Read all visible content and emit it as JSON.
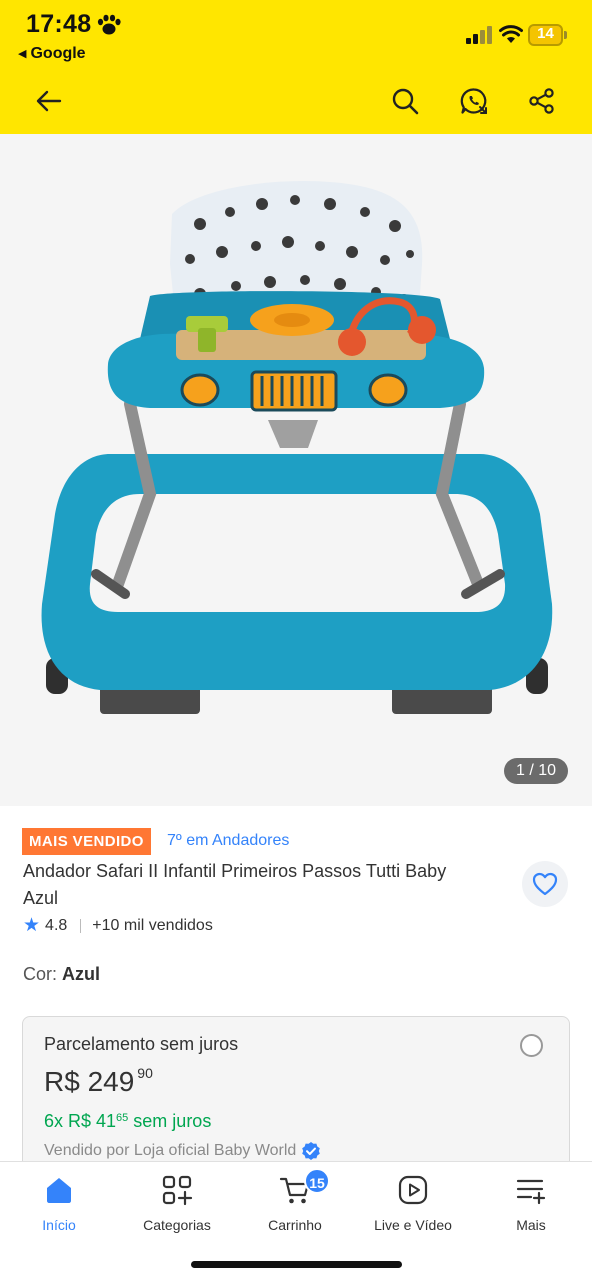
{
  "status_bar": {
    "time": "17:48",
    "back_app": "Google",
    "battery": "14"
  },
  "toolbar": {
    "icons": [
      "back-arrow-icon",
      "search-icon",
      "whatsapp-icon",
      "share-icon"
    ]
  },
  "gallery": {
    "counter": "1 / 10"
  },
  "product": {
    "badge": "MAIS VENDIDO",
    "rank": "7º em Andadores",
    "title": "Andador Safari II Infantil Primeiros Passos Tutti Baby Azul",
    "rating": "4.8",
    "sold": "+10 mil vendidos",
    "color_label": "Cor:",
    "color_value": "Azul"
  },
  "installment": {
    "title": "Parcelamento sem juros",
    "price_main": "R$ 249",
    "price_cents": "90",
    "install_text": "6x R$ 41",
    "install_cents": "65",
    "install_suffix": " sem juros",
    "seller": "Vendido por Loja oficial Baby World"
  },
  "bottom_nav": {
    "items": [
      {
        "label": "Início",
        "icon": "home-icon",
        "active": true
      },
      {
        "label": "Categorias",
        "icon": "categories-icon"
      },
      {
        "label": "Carrinho",
        "icon": "cart-icon",
        "badge": "15"
      },
      {
        "label": "Live e Vídeo",
        "icon": "play-icon"
      },
      {
        "label": "Mais",
        "icon": "menu-plus-icon"
      }
    ]
  },
  "colors": {
    "header_yellow": "#ffe600",
    "accent_blue": "#3483fa",
    "badge_orange": "#ff7733",
    "install_green": "#00a650",
    "walker_teal": "#1e9fc4"
  }
}
